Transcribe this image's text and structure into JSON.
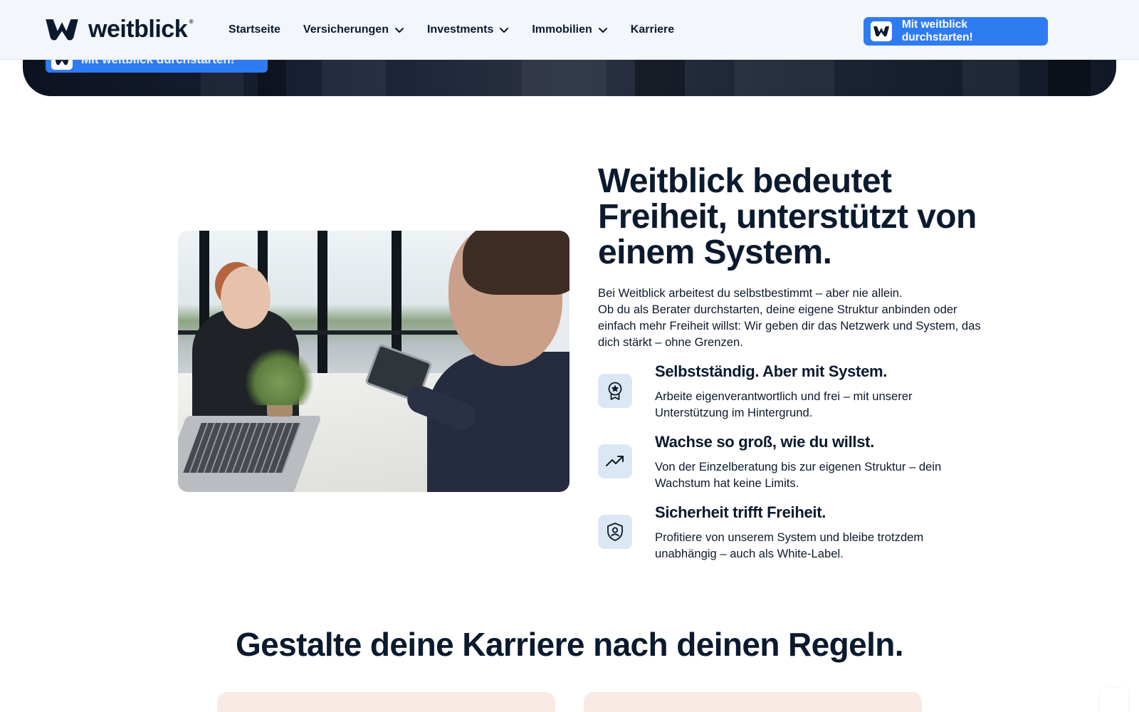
{
  "brand": {
    "name": "weitblick",
    "reg_mark": "®"
  },
  "nav": {
    "items": [
      {
        "label": "Startseite",
        "dropdown": false
      },
      {
        "label": "Versicherungen",
        "dropdown": true
      },
      {
        "label": "Investments",
        "dropdown": true
      },
      {
        "label": "Immobilien",
        "dropdown": true
      },
      {
        "label": "Karriere",
        "dropdown": false
      }
    ]
  },
  "header_cta": {
    "label": "Mit weitblick durchstarten!"
  },
  "hero": {
    "cta_label": "Mit weitblick durchstarten!"
  },
  "intro_section": {
    "headline": "Weitblick bedeutet Freiheit, unterstützt von einem System.",
    "paragraph_line1": "Bei Weitblick arbeitest du selbstbestimmt – aber nie allein.",
    "paragraph_line2": "Ob du als Berater durchstarten, deine eigene Struktur anbinden oder einfach mehr Freiheit willst: Wir geben dir das Netzwerk und System, das dich stärkt – ohne Grenzen.",
    "features": [
      {
        "icon": "award-badge-icon",
        "title": "Selbstständig. Aber mit System.",
        "text": "Arbeite eigenverantwortlich und frei – mit unserer Unterstützung im Hintergrund."
      },
      {
        "icon": "trending-up-icon",
        "title": "Wachse so groß, wie du willst.",
        "text": "Von der Einzelberatung bis zur eigenen Struktur – dein Wachstum hat keine Limits."
      },
      {
        "icon": "shield-user-icon",
        "title": "Sicherheit trifft Freiheit.",
        "text": "Profitiere von unserem System und bleibe trotzdem unabhängig – auch als White-Label."
      }
    ]
  },
  "career_section": {
    "title": "Gestalte deine Karriere nach deinen Regeln."
  },
  "colors": {
    "primary": "#2f7bf2",
    "text": "#0b1a2e",
    "icon_bg": "#dbe7f5",
    "card_bg": "#f8ebe3",
    "header_bg": "#f3f6fa"
  }
}
